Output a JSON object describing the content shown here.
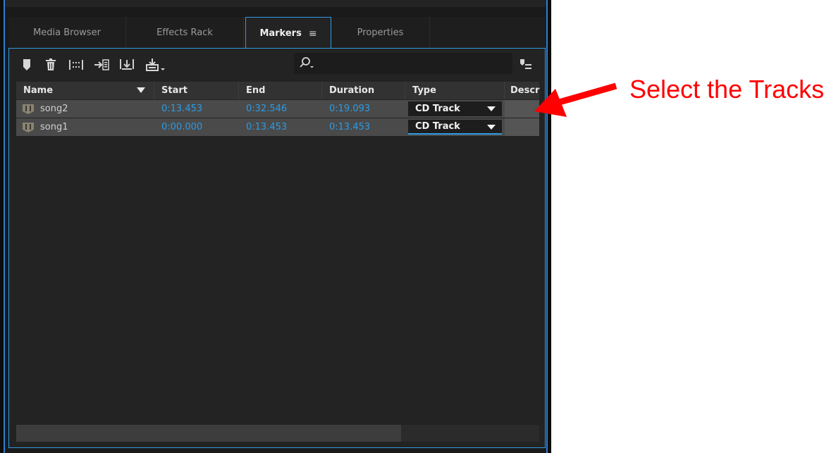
{
  "tabs": [
    {
      "label": "Media Browser",
      "active": false
    },
    {
      "label": "Effects Rack",
      "active": false
    },
    {
      "label": "Markers",
      "active": true,
      "menu_icon": "hamburger-menu-icon"
    },
    {
      "label": "Properties",
      "active": false
    }
  ],
  "toolbar": {
    "icons": [
      "add-marker-icon",
      "delete-marker-icon",
      "merge-markers-icon",
      "insert-into-playlist-icon",
      "export-selection-icon",
      "export-icon"
    ],
    "search_placeholder": "",
    "search_icon": "search-icon",
    "right_icon": "marker-list-options-icon"
  },
  "table": {
    "columns": [
      "Name",
      "Start",
      "End",
      "Duration",
      "Type",
      "Descr"
    ],
    "sort_icon": "sort-down-icon",
    "rows": [
      {
        "name": "song2",
        "start": "0:13.453",
        "end": "0:32.546",
        "duration": "0:19.093",
        "type": "CD Track"
      },
      {
        "name": "song1",
        "start": "0:00.000",
        "end": "0:13.453",
        "duration": "0:13.453",
        "type": "CD Track"
      }
    ]
  },
  "annotation": {
    "text": "Select the Tracks",
    "color": "#ff0000"
  },
  "colors": {
    "accent": "#2f9be0",
    "time_text": "#2c9be3",
    "panel_bg": "#232323",
    "row_bg": "#4a4a4a"
  }
}
